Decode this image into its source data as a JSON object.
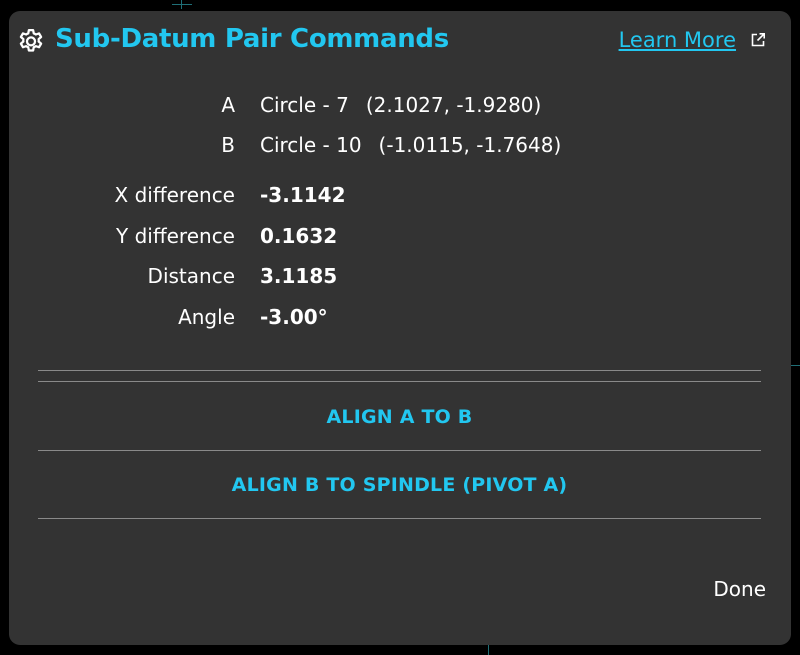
{
  "dialog": {
    "title": "Sub-Datum Pair Commands",
    "learn_more": "Learn More",
    "points": [
      {
        "label": "A",
        "name": "Circle - 7",
        "coords": "(2.1027, -1.9280)"
      },
      {
        "label": "B",
        "name": "Circle - 10",
        "coords": "(-1.0115, -1.7648)"
      }
    ],
    "metrics": [
      {
        "label": "X difference",
        "value": "-3.1142"
      },
      {
        "label": "Y difference",
        "value": "0.1632"
      },
      {
        "label": "Distance",
        "value": "3.1185"
      },
      {
        "label": "Angle",
        "value": "-3.00°"
      }
    ],
    "actions": {
      "align_a_to_b": "ALIGN A TO B",
      "align_b_to_spindle": "ALIGN B TO SPINDLE (PIVOT A)"
    },
    "done": "Done"
  },
  "colors": {
    "accent": "#22c7f0",
    "dialog_bg": "#333333",
    "text": "#ffffff"
  },
  "icons": {
    "title_icon": "gear-icon",
    "learn_more_icon": "external-link-icon"
  }
}
